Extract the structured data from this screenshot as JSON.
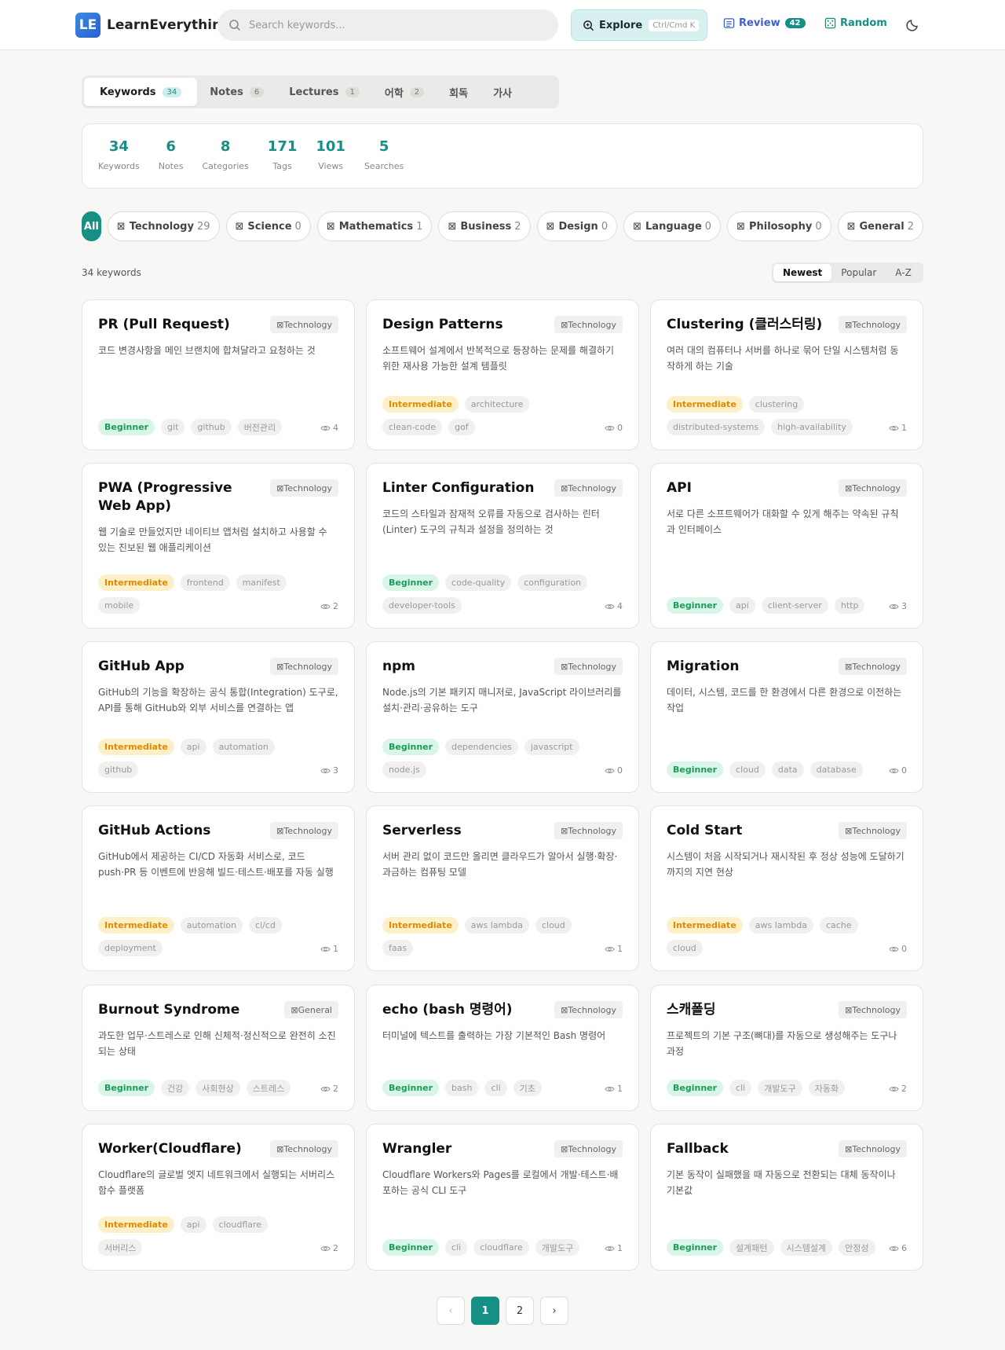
{
  "header": {
    "logo_badge": "LE",
    "logo_text": "LearnEverything",
    "search_placeholder": "Search keywords...",
    "explore_label": "Explore",
    "explore_shortcut": "Ctrl/Cmd K",
    "review_label": "Review",
    "review_count": "42",
    "random_label": "Random"
  },
  "tabs": [
    {
      "label": "Keywords",
      "count": "34"
    },
    {
      "label": "Notes",
      "count": "6"
    },
    {
      "label": "Lectures",
      "count": "1"
    },
    {
      "label": "어학",
      "count": "2"
    },
    {
      "label": "회독",
      "count": ""
    },
    {
      "label": "가사",
      "count": ""
    }
  ],
  "stats": [
    {
      "num": "34",
      "label": "Keywords"
    },
    {
      "num": "6",
      "label": "Notes"
    },
    {
      "num": "8",
      "label": "Categories"
    },
    {
      "num": "171",
      "label": "Tags"
    },
    {
      "num": "101",
      "label": "Views"
    },
    {
      "num": "5",
      "label": "Searches"
    }
  ],
  "categories": [
    {
      "label": "All",
      "count": ""
    },
    {
      "label": "Technology",
      "count": "29"
    },
    {
      "label": "Science",
      "count": "0"
    },
    {
      "label": "Mathematics",
      "count": "1"
    },
    {
      "label": "Business",
      "count": "2"
    },
    {
      "label": "Design",
      "count": "0"
    },
    {
      "label": "Language",
      "count": "0"
    },
    {
      "label": "Philosophy",
      "count": "0"
    },
    {
      "label": "General",
      "count": "2"
    }
  ],
  "result_count": "34 keywords",
  "sort": [
    "Newest",
    "Popular",
    "A-Z"
  ],
  "cards": [
    {
      "title": "PR (Pull Request)",
      "category": "Technology",
      "desc": "코드 변경사항을 메인 브랜치에 합쳐달라고 요청하는 것",
      "level": "Beginner",
      "tags": [
        "git",
        "github",
        "버전관리"
      ],
      "views": "4"
    },
    {
      "title": "Design Patterns",
      "category": "Technology",
      "desc": "소프트웨어 설계에서 반복적으로 등장하는 문제를 해결하기 위한 재사용 가능한 설계 템플릿",
      "level": "Intermediate",
      "tags": [
        "architecture",
        "clean-code",
        "gof"
      ],
      "views": "0"
    },
    {
      "title": "Clustering (클러스터링)",
      "category": "Technology",
      "desc": "여러 대의 컴퓨터나 서버를 하나로 묶어 단일 시스템처럼 동작하게 하는 기술",
      "level": "Intermediate",
      "tags": [
        "clustering",
        "distributed-systems",
        "high-availability"
      ],
      "views": "1"
    },
    {
      "title": "PWA (Progressive Web App)",
      "category": "Technology",
      "desc": "웹 기술로 만들었지만 네이티브 앱처럼 설치하고 사용할 수 있는 진보된 웹 애플리케이션",
      "level": "Intermediate",
      "tags": [
        "frontend",
        "manifest",
        "mobile"
      ],
      "views": "2"
    },
    {
      "title": "Linter Configuration",
      "category": "Technology",
      "desc": "코드의 스타일과 잠재적 오류를 자동으로 검사하는 린터(Linter) 도구의 규칙과 설정을 정의하는 것",
      "level": "Beginner",
      "tags": [
        "code-quality",
        "configuration",
        "developer-tools"
      ],
      "views": "4"
    },
    {
      "title": "API",
      "category": "Technology",
      "desc": "서로 다른 소프트웨어가 대화할 수 있게 해주는 약속된 규칙과 인터페이스",
      "level": "Beginner",
      "tags": [
        "api",
        "client-server",
        "http"
      ],
      "views": "3"
    },
    {
      "title": "GitHub App",
      "category": "Technology",
      "desc": "GitHub의 기능을 확장하는 공식 통합(Integration) 도구로, API를 통해 GitHub와 외부 서비스를 연결하는 앱",
      "level": "Intermediate",
      "tags": [
        "api",
        "automation",
        "github"
      ],
      "views": "3"
    },
    {
      "title": "npm",
      "category": "Technology",
      "desc": "Node.js의 기본 패키지 매니저로, JavaScript 라이브러리를 설치·관리·공유하는 도구",
      "level": "Beginner",
      "tags": [
        "dependencies",
        "javascript",
        "node.js"
      ],
      "views": "0"
    },
    {
      "title": "Migration",
      "category": "Technology",
      "desc": "데이터, 시스템, 코드를 한 환경에서 다른 환경으로 이전하는 작업",
      "level": "Beginner",
      "tags": [
        "cloud",
        "data",
        "database"
      ],
      "views": "0"
    },
    {
      "title": "GitHub Actions",
      "category": "Technology",
      "desc": "GitHub에서 제공하는 CI/CD 자동화 서비스로, 코드 push·PR 등 이벤트에 반응해 빌드·테스트·배포를 자동 실행",
      "level": "Intermediate",
      "tags": [
        "automation",
        "ci/cd",
        "deployment"
      ],
      "views": "1"
    },
    {
      "title": "Serverless",
      "category": "Technology",
      "desc": "서버 관리 없이 코드만 올리면 클라우드가 알아서 실행·확장·과금하는 컴퓨팅 모델",
      "level": "Intermediate",
      "tags": [
        "aws lambda",
        "cloud",
        "faas"
      ],
      "views": "1"
    },
    {
      "title": "Cold Start",
      "category": "Technology",
      "desc": "시스템이 처음 시작되거나 재시작된 후 정상 성능에 도달하기까지의 지연 현상",
      "level": "Intermediate",
      "tags": [
        "aws lambda",
        "cache",
        "cloud"
      ],
      "views": "0"
    },
    {
      "title": "Burnout Syndrome",
      "category": "General",
      "desc": "과도한 업무·스트레스로 인해 신체적·정신적으로 완전히 소진되는 상태",
      "level": "Beginner",
      "tags": [
        "건강",
        "사회현상",
        "스트레스"
      ],
      "views": "2"
    },
    {
      "title": "echo (bash 명령어)",
      "category": "Technology",
      "desc": "터미널에 텍스트를 출력하는 가장 기본적인 Bash 명령어",
      "level": "Beginner",
      "tags": [
        "bash",
        "cli",
        "기초"
      ],
      "views": "1"
    },
    {
      "title": "스캐폴딩",
      "category": "Technology",
      "desc": "프로젝트의 기본 구조(뼈대)를 자동으로 생성해주는 도구나 과정",
      "level": "Beginner",
      "tags": [
        "cli",
        "개발도구",
        "자동화"
      ],
      "views": "2"
    },
    {
      "title": "Worker(Cloudflare)",
      "category": "Technology",
      "desc": "Cloudflare의 글로벌 엣지 네트워크에서 실행되는 서버리스 함수 플랫폼",
      "level": "Intermediate",
      "tags": [
        "api",
        "cloudflare",
        "서버리스"
      ],
      "views": "2"
    },
    {
      "title": "Wrangler",
      "category": "Technology",
      "desc": "Cloudflare Workers와 Pages를 로컬에서 개발·테스트·배포하는 공식 CLI 도구",
      "level": "Beginner",
      "tags": [
        "cli",
        "cloudflare",
        "개발도구"
      ],
      "views": "1"
    },
    {
      "title": "Fallback",
      "category": "Technology",
      "desc": "기본 동작이 실패했을 때 자동으로 전환되는 대체 동작이나 기본값",
      "level": "Beginner",
      "tags": [
        "설계패턴",
        "시스템설계",
        "안정성"
      ],
      "views": "6"
    }
  ],
  "pagination": {
    "prev": "‹",
    "pages": [
      "1",
      "2"
    ],
    "next": "›"
  },
  "colors": {
    "accent": "#168f84",
    "review": "#3f5fce",
    "beginner": "#1f9a5d",
    "intermediate": "#e08b00"
  }
}
